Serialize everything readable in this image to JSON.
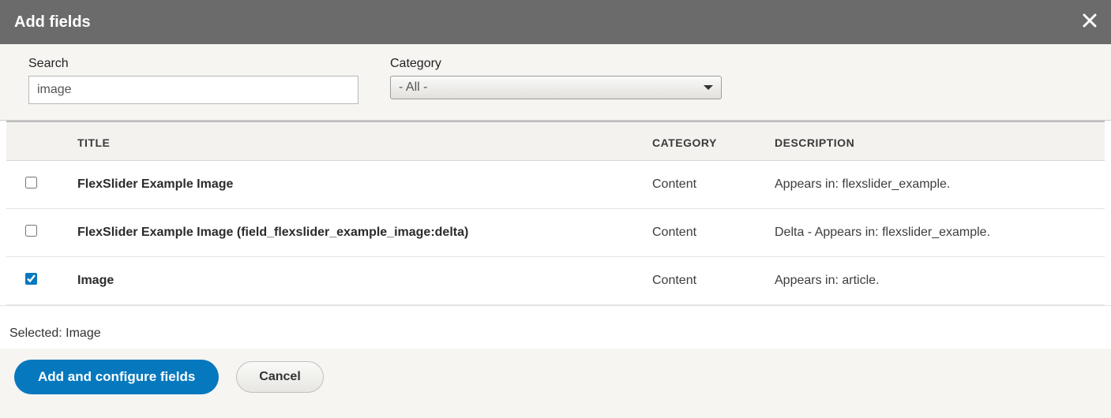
{
  "dialog": {
    "title": "Add fields"
  },
  "filters": {
    "search_label": "Search",
    "search_value": "image",
    "category_label": "Category",
    "category_selected": "- All -"
  },
  "columns": {
    "title": "TITLE",
    "category": "CATEGORY",
    "description": "DESCRIPTION"
  },
  "rows": [
    {
      "checked": false,
      "title": "FlexSlider Example Image",
      "category": "Content",
      "description": "Appears in: flexslider_example."
    },
    {
      "checked": false,
      "title": "FlexSlider Example Image (field_flexslider_example_image:delta)",
      "category": "Content",
      "description": "Delta - Appears in: flexslider_example."
    },
    {
      "checked": true,
      "title": "Image",
      "category": "Content",
      "description": "Appears in: article."
    }
  ],
  "selected_text": "Selected: Image",
  "buttons": {
    "primary": "Add and configure fields",
    "cancel": "Cancel"
  }
}
